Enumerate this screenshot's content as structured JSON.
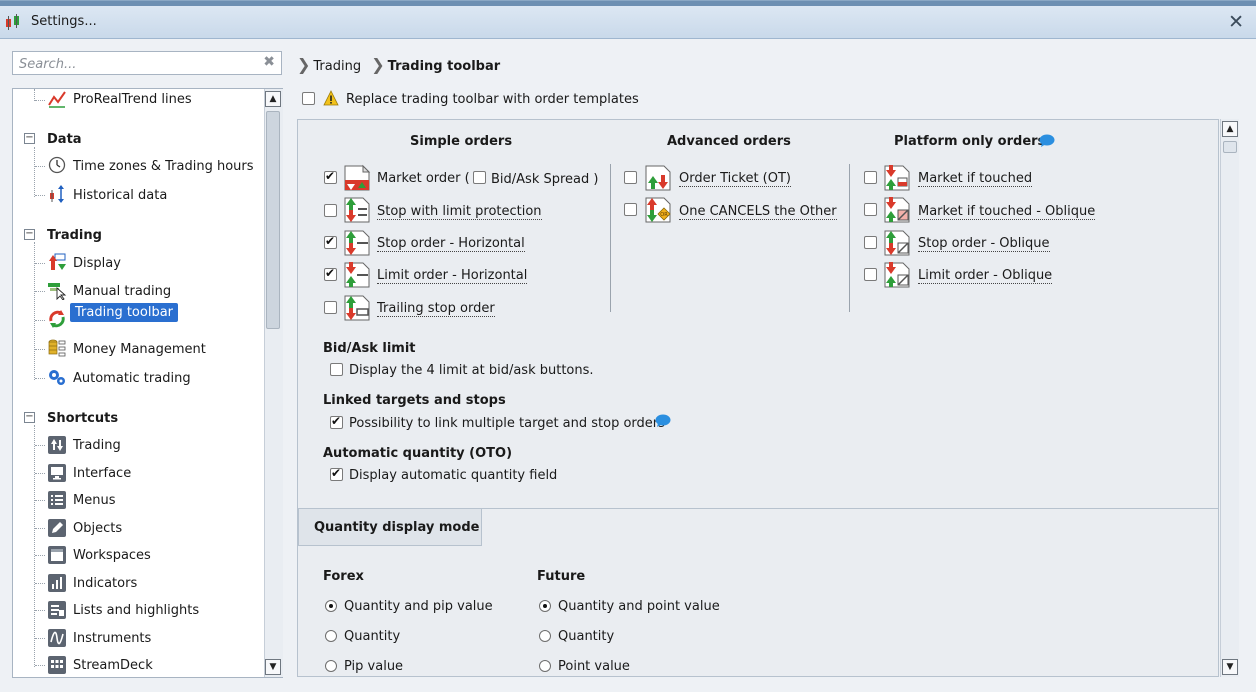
{
  "window": {
    "title": "Settings...",
    "close_glyph": "✕"
  },
  "search": {
    "placeholder": "Search...",
    "clear_glyph": "✖"
  },
  "tree": {
    "items": [
      {
        "label": "ProRealTrend lines",
        "icon": "trendline-icon"
      },
      {
        "label": "Data",
        "category": true
      },
      {
        "label": "Time zones & Trading hours",
        "icon": "clock-icon"
      },
      {
        "label": "Historical data",
        "icon": "historical-data-icon"
      },
      {
        "label": "Trading",
        "category": true
      },
      {
        "label": "Display",
        "icon": "display-icon"
      },
      {
        "label": "Manual trading",
        "icon": "manual-trading-icon"
      },
      {
        "label": "Trading toolbar",
        "icon": "trading-toolbar-icon",
        "selected": true
      },
      {
        "label": "Money Management",
        "icon": "money-management-icon"
      },
      {
        "label": "Automatic trading",
        "icon": "gears-icon"
      },
      {
        "label": "Shortcuts",
        "category": true
      },
      {
        "label": "Trading",
        "icon": "trading-shortcut-icon"
      },
      {
        "label": "Interface",
        "icon": "monitor-icon"
      },
      {
        "label": "Menus",
        "icon": "menu-list-icon"
      },
      {
        "label": "Objects",
        "icon": "pencil-icon"
      },
      {
        "label": "Workspaces",
        "icon": "workspace-icon"
      },
      {
        "label": "Indicators",
        "icon": "bar-chart-icon"
      },
      {
        "label": "Lists and highlights",
        "icon": "list-highlight-icon"
      },
      {
        "label": "Instruments",
        "icon": "wave-icon"
      },
      {
        "label": "StreamDeck",
        "icon": "streamdeck-icon"
      }
    ]
  },
  "breadcrumb": {
    "parent": "Trading",
    "current": "Trading toolbar"
  },
  "replace_toolbar": {
    "label": "Replace trading toolbar with order templates",
    "checked": false
  },
  "columns": {
    "simple": "Simple orders",
    "advanced": "Advanced orders",
    "platform": "Platform only orders"
  },
  "simple_orders": [
    {
      "label": "Market order (",
      "checked": true
    },
    {
      "label": "Stop with limit protection",
      "checked": false
    },
    {
      "label": "Stop order - Horizontal",
      "checked": true
    },
    {
      "label": "Limit order - Horizontal",
      "checked": true
    },
    {
      "label": "Trailing stop order",
      "checked": false
    }
  ],
  "bid_ask_spread": {
    "label": "Bid/Ask Spread )",
    "checked": false
  },
  "advanced_orders": [
    {
      "label": "Order Ticket (OT)",
      "checked": false
    },
    {
      "label": "One CANCELS the Other",
      "checked": false
    }
  ],
  "platform_orders": [
    {
      "label": "Market if touched",
      "checked": false
    },
    {
      "label": "Market if touched - Oblique",
      "checked": false
    },
    {
      "label": "Stop order - Oblique",
      "checked": false
    },
    {
      "label": "Limit order - Oblique",
      "checked": false
    }
  ],
  "bid_ask_limit": {
    "title": "Bid/Ask limit",
    "option": "Display the 4 limit at bid/ask buttons.",
    "checked": false
  },
  "linked": {
    "title": "Linked targets and stops",
    "option": "Possibility to link multiple target and stop orders",
    "checked": true
  },
  "auto_qty": {
    "title": "Automatic quantity (OTO)",
    "option": "Display automatic quantity field",
    "checked": true
  },
  "quantity_tab": {
    "label": "Quantity display mode"
  },
  "forex": {
    "title": "Forex",
    "options": [
      "Quantity and pip value",
      "Quantity",
      "Pip value"
    ],
    "selected": 0
  },
  "future": {
    "title": "Future",
    "options": [
      "Quantity and point value",
      "Quantity",
      "Point value"
    ],
    "selected": 0
  },
  "colors": {
    "selection": "#2a6fd0",
    "up_green": "#2e9e3a",
    "down_red": "#d93a2b",
    "info_blue": "#2b8fe0"
  }
}
